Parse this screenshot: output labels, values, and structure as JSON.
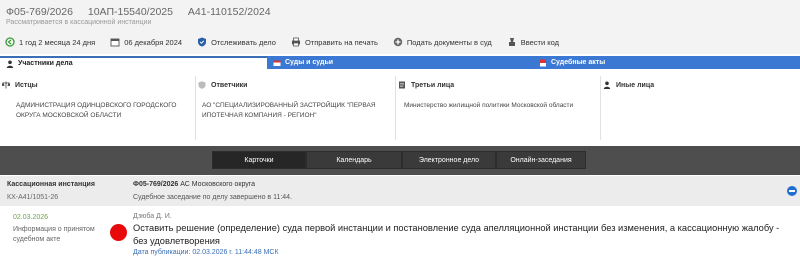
{
  "header": {
    "case_numbers": [
      "Ф05-769/2026",
      "10АП-15540/2025",
      "А41-110152/2024"
    ],
    "subtitle": "Рассматривается в кассационной инстанции",
    "toolbar": [
      {
        "icon": "duration-icon",
        "label": "1 год 2 месяца 24 дня"
      },
      {
        "icon": "calendar-icon",
        "label": "06 декабря 2024"
      },
      {
        "icon": "watch-icon",
        "label": "Отслеживать дело"
      },
      {
        "icon": "print-icon",
        "label": "Отправить на печать"
      },
      {
        "icon": "submit-docs-icon",
        "label": "Подать документы в суд"
      },
      {
        "icon": "code-icon",
        "label": "Ввести код"
      }
    ]
  },
  "tabs": {
    "participants": "Участники дела",
    "courts": "Суды и судьи",
    "acts": "Судебные акты"
  },
  "participants": {
    "plaintiffs": {
      "title": "Истцы",
      "text": "АДМИНИСТРАЦИЯ ОДИНЦОВСКОГО ГОРОДСКОГО ОКРУГА МОСКОВСКОЙ ОБЛАСТИ"
    },
    "defendants": {
      "title": "Ответчики",
      "text": "АО \"СПЕЦИАЛИЗИРОВАННЫЙ ЗАСТРОЙЩИК \"ПЕРВАЯ ИПОТЕЧНАЯ КОМПАНИЯ - РЕГИОН\""
    },
    "third_parties": {
      "title": "Третьи лица",
      "text": "Министерство жилищной политики Московской области"
    },
    "others": {
      "title": "Иные лица",
      "text": ""
    }
  },
  "view_tabs": [
    "Карточки",
    "Календарь",
    "Электронное дело",
    "Онлайн-заседания"
  ],
  "instance": {
    "label": "Кассационная инстанция",
    "number": "КХ-А41/1051-26",
    "case_no": "Ф05-769/2026",
    "court": "АС Московского округа",
    "status": "Судебное заседание по делу завершено в 11:44."
  },
  "event": {
    "date": "02.03.2026",
    "type": "Информация о принятом судебном акте",
    "judge": "Дзюба Д. И.",
    "text": "Оставить решение (определение) суда первой инстанции и постановление суда апелляционной инстанции без изменения, а кассационную жалобу - без удовлетворения",
    "published": "Дата публикации: 02.03.2026 г. 11:44:48 МСК"
  },
  "colors": {
    "accent_blue": "#3a78d4",
    "dark_bar": "#4e4e4e",
    "status_red": "#e8090b",
    "date_green": "#6fa24a"
  }
}
